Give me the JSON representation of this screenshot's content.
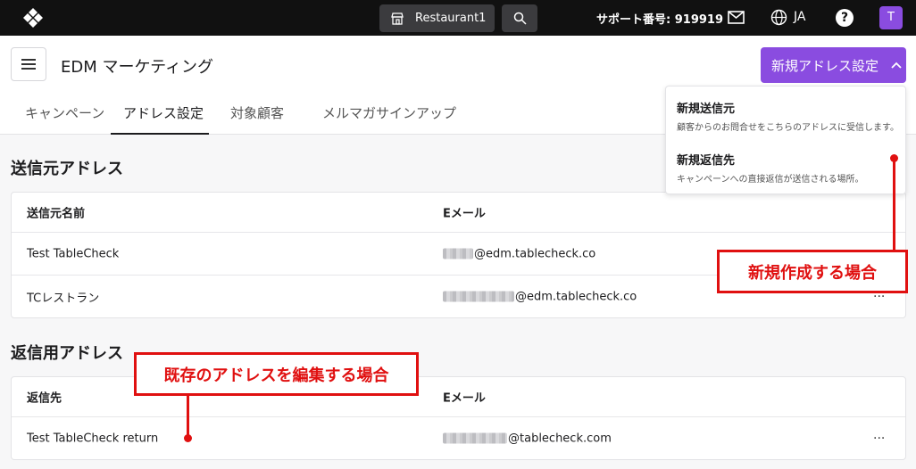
{
  "topbar": {
    "venue": "Restaurant1",
    "support": "サポート番号: 919919",
    "lang": "JA",
    "help": "?",
    "avatar": "T"
  },
  "header": {
    "title": "EDM マーケティング",
    "new_button": "新規アドレス設定",
    "tabs": [
      "キャンペーン",
      "アドレス設定",
      "対象顧客",
      "メルマガサインアップ"
    ]
  },
  "sender": {
    "title": "送信元アドレス",
    "col_name": "送信元名前",
    "col_email": "Eメール",
    "rows": [
      {
        "name": "Test TableCheck",
        "email": "@edm.tablecheck.co"
      },
      {
        "name": "TCレストラン",
        "email": "@edm.tablecheck.co"
      }
    ]
  },
  "reply": {
    "title": "返信用アドレス",
    "col_name": "返信先",
    "col_email": "Eメール",
    "rows": [
      {
        "name": "Test TableCheck return",
        "email": "@tablecheck.com"
      }
    ]
  },
  "dropdown": {
    "items": [
      {
        "title": "新規送信元",
        "desc": "顧客からのお問合せをこちらのアドレスに受信します。"
      },
      {
        "title": "新規返信先",
        "desc": "キャンペーンへの直接返信が送信される場所。"
      }
    ]
  },
  "annotations": {
    "new": "新規作成する場合",
    "edit": "既存のアドレスを編集する場合"
  },
  "row_menu": "···",
  "colors": {
    "accent": "#8a4ce0",
    "topbar": "#111111",
    "annotation": "#e01010"
  }
}
